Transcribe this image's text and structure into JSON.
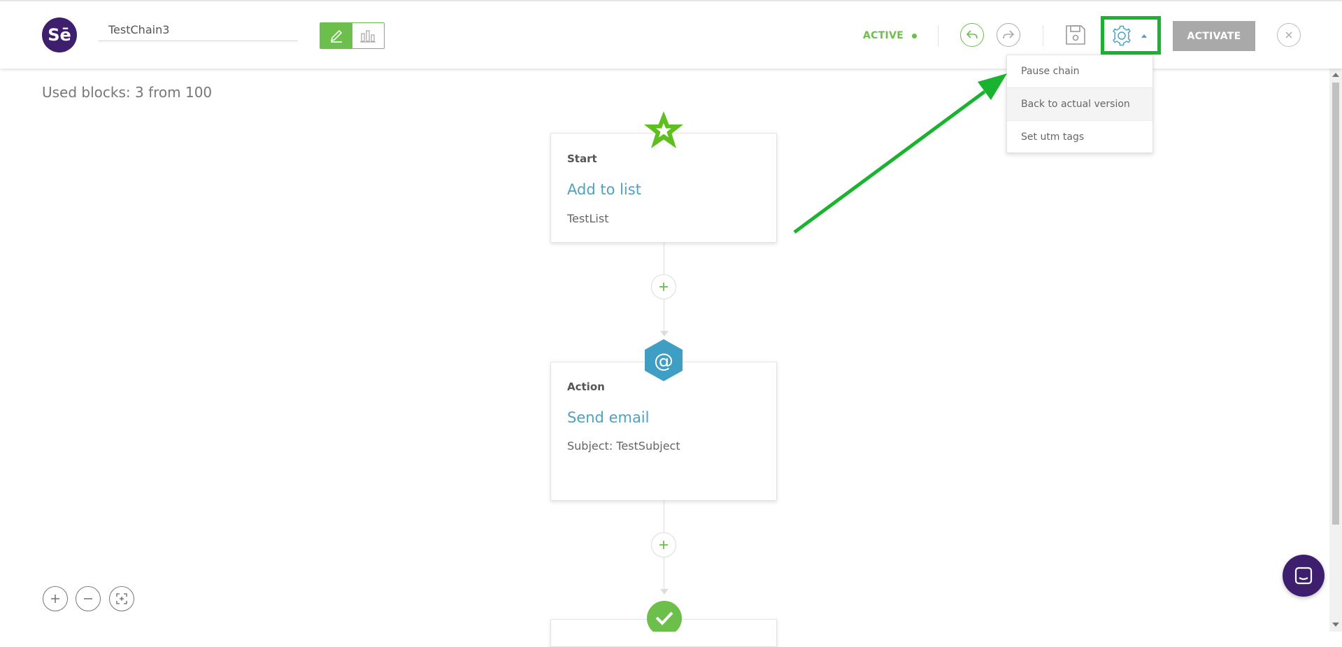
{
  "app": {
    "logo_text": "Sē",
    "chain_name": "TestChain3"
  },
  "header": {
    "status_label": "ACTIVE",
    "activate_label": "ACTIVATE"
  },
  "settings_menu": {
    "items": [
      {
        "label": "Pause chain"
      },
      {
        "label": "Back to actual version"
      },
      {
        "label": "Set utm tags"
      }
    ]
  },
  "canvas": {
    "used_blocks": "Used blocks: 3 from 100",
    "blocks": [
      {
        "kind": "Start",
        "title": "Add to list",
        "detail": "TestList",
        "icon": "star-icon"
      },
      {
        "kind": "Action",
        "title": "Send email",
        "detail": "Subject: TestSubject",
        "icon": "at-sign-icon"
      },
      {
        "icon": "check-icon"
      }
    ],
    "action_icon_glyph": "@"
  },
  "colors": {
    "brand": "#3d1f6e",
    "accent_green": "#6bbf4a",
    "link_blue": "#4aa3c4",
    "annotation_green": "#19b32f"
  },
  "annotation": {
    "highlight_target": "gear-icon",
    "arrow_color": "#19b32f"
  }
}
